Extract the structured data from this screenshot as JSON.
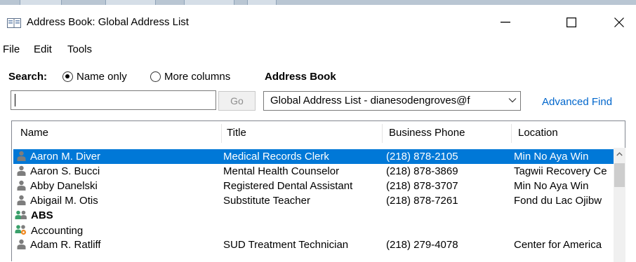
{
  "window": {
    "title": "Address Book: Global Address List",
    "minimize_label": "Minimize",
    "maximize_label": "Maximize",
    "close_label": "Close"
  },
  "menu": {
    "items": [
      "File",
      "Edit",
      "Tools"
    ]
  },
  "search": {
    "label": "Search:",
    "options": [
      {
        "label": "Name only",
        "selected": true
      },
      {
        "label": "More columns",
        "selected": false
      }
    ],
    "input_value": "",
    "go_label": "Go"
  },
  "address_book": {
    "label": "Address Book",
    "selected": "Global Address List - dianesodengroves@f",
    "advanced_find_label": "Advanced Find"
  },
  "list": {
    "columns": [
      "Name",
      "Title",
      "Business Phone",
      "Location"
    ],
    "rows": [
      {
        "icon": "user-icon",
        "name": "Aaron M. Diver",
        "title": "Medical Records Clerk",
        "phone": "(218) 878-2105",
        "location": "Min No Aya Win",
        "selected": true,
        "bold": false
      },
      {
        "icon": "user-icon",
        "name": "Aaron S. Bucci",
        "title": "Mental Health Counselor",
        "phone": "(218) 878-3869",
        "location": "Tagwii Recovery Ce",
        "selected": false,
        "bold": false
      },
      {
        "icon": "user-icon",
        "name": "Abby Danelski",
        "title": "Registered Dental Assistant",
        "phone": "(218) 878-3707",
        "location": "Min No Aya Win",
        "selected": false,
        "bold": false
      },
      {
        "icon": "user-icon",
        "name": "Abigail M. Otis",
        "title": "Substitute Teacher",
        "phone": "(218) 878-7261",
        "location": "Fond du Lac Ojibw",
        "selected": false,
        "bold": false
      },
      {
        "icon": "group-icon",
        "name": "ABS",
        "title": "",
        "phone": "",
        "location": "",
        "selected": false,
        "bold": true
      },
      {
        "icon": "dynamic-group-icon",
        "name": "Accounting",
        "title": "",
        "phone": "",
        "location": "",
        "selected": false,
        "bold": false
      },
      {
        "icon": "user-icon",
        "name": "Adam R. Ratliff",
        "title": "SUD Treatment Technician",
        "phone": "(218) 279-4078",
        "location": "Center for America",
        "selected": false,
        "bold": false
      }
    ]
  },
  "colors": {
    "selection": "#0078d7",
    "link": "#0066cc",
    "user_icon": "#7d7d7d",
    "group_icon_accent": "#3aa06b",
    "dynamic_group_accent": "#f08a24"
  }
}
